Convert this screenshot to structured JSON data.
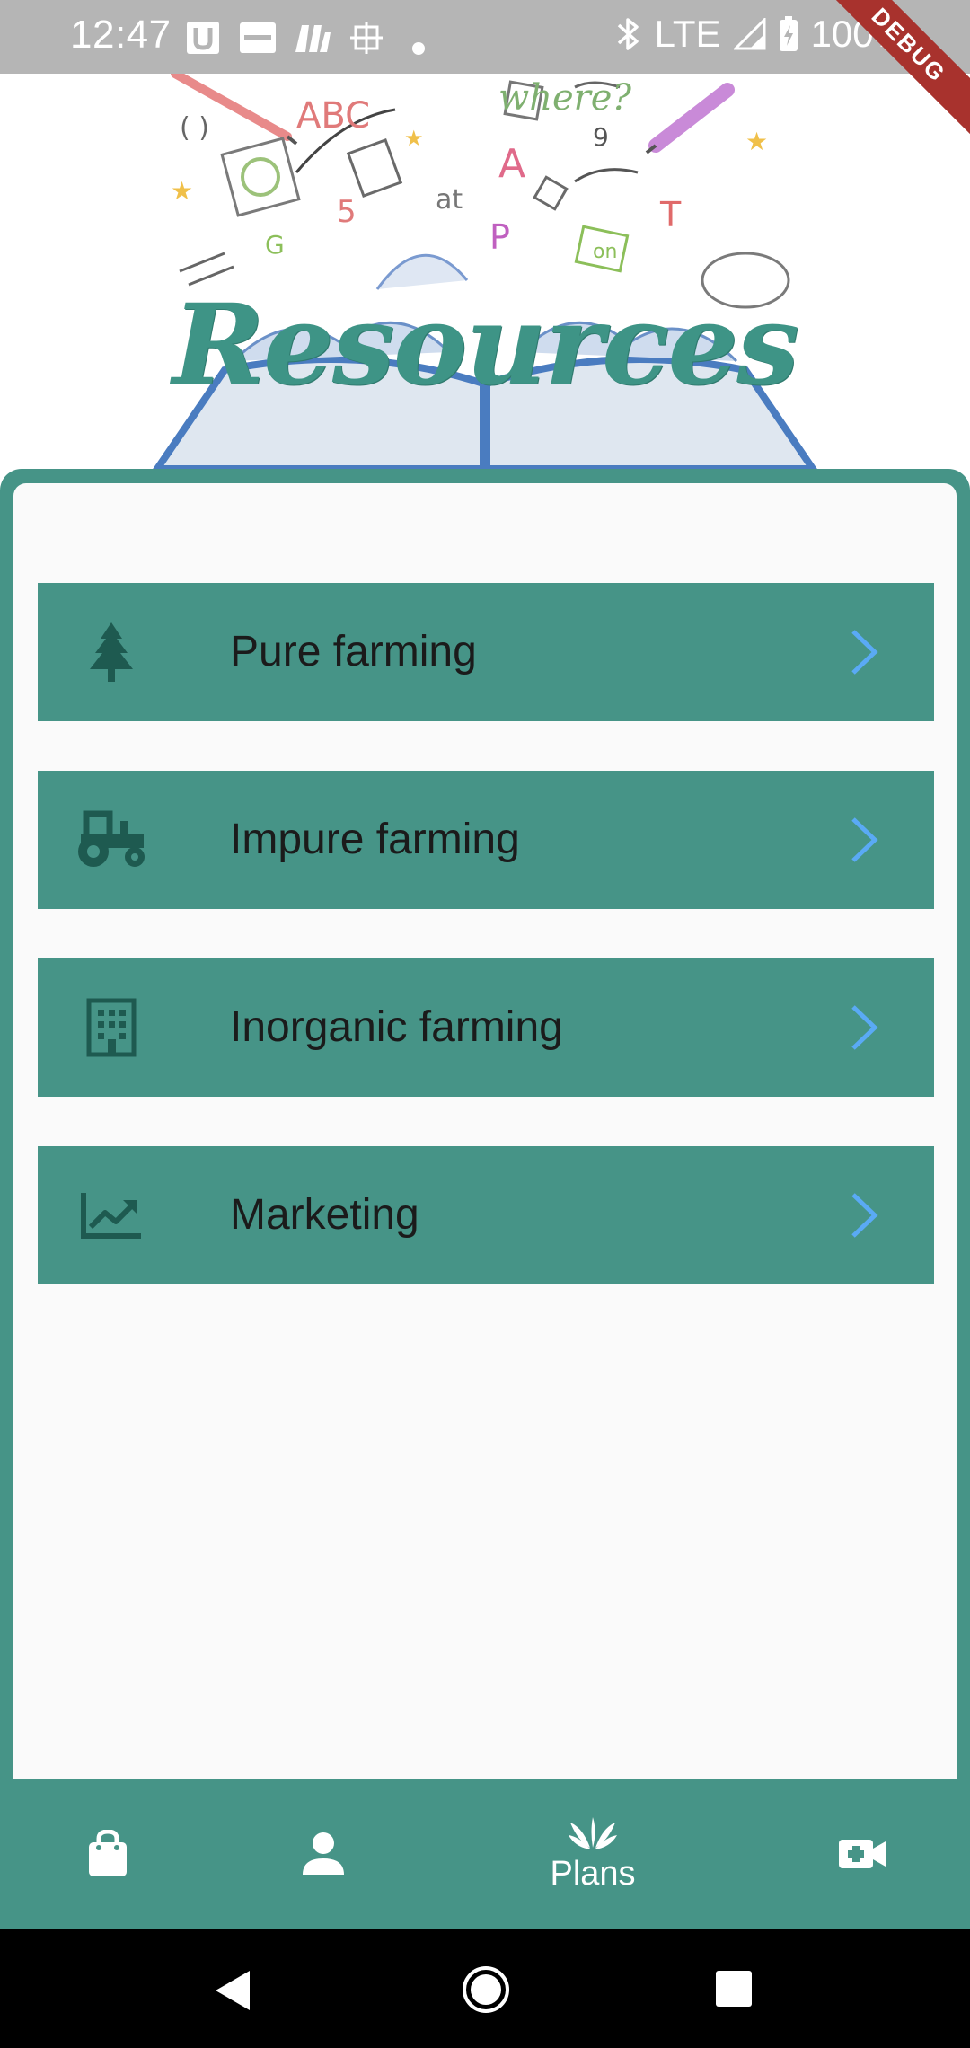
{
  "status_bar": {
    "time": "12:47",
    "network": "LTE",
    "battery": "100%",
    "debug_banner": "DEBUG"
  },
  "header": {
    "title": "Resources"
  },
  "menu": {
    "items": [
      {
        "label": "Pure farming",
        "icon": "tree-icon"
      },
      {
        "label": "Impure farming",
        "icon": "tractor-icon"
      },
      {
        "label": "Inorganic farming",
        "icon": "building-icon"
      },
      {
        "label": "Marketing",
        "icon": "trending-chart-icon"
      }
    ]
  },
  "bottom_nav": {
    "items": [
      {
        "icon": "shopping-bag-icon",
        "label": ""
      },
      {
        "icon": "person-icon",
        "label": ""
      },
      {
        "icon": "plant-icon",
        "label": "Plans"
      },
      {
        "icon": "video-call-icon",
        "label": ""
      }
    ],
    "active": "Plans"
  },
  "colors": {
    "accent": "#469487",
    "title": "#3e9486",
    "chevron": "#5aaaf5",
    "card_bg": "#fafafa",
    "icon_dark": "#1e5a50",
    "status_bar": "#b5b5b5"
  }
}
